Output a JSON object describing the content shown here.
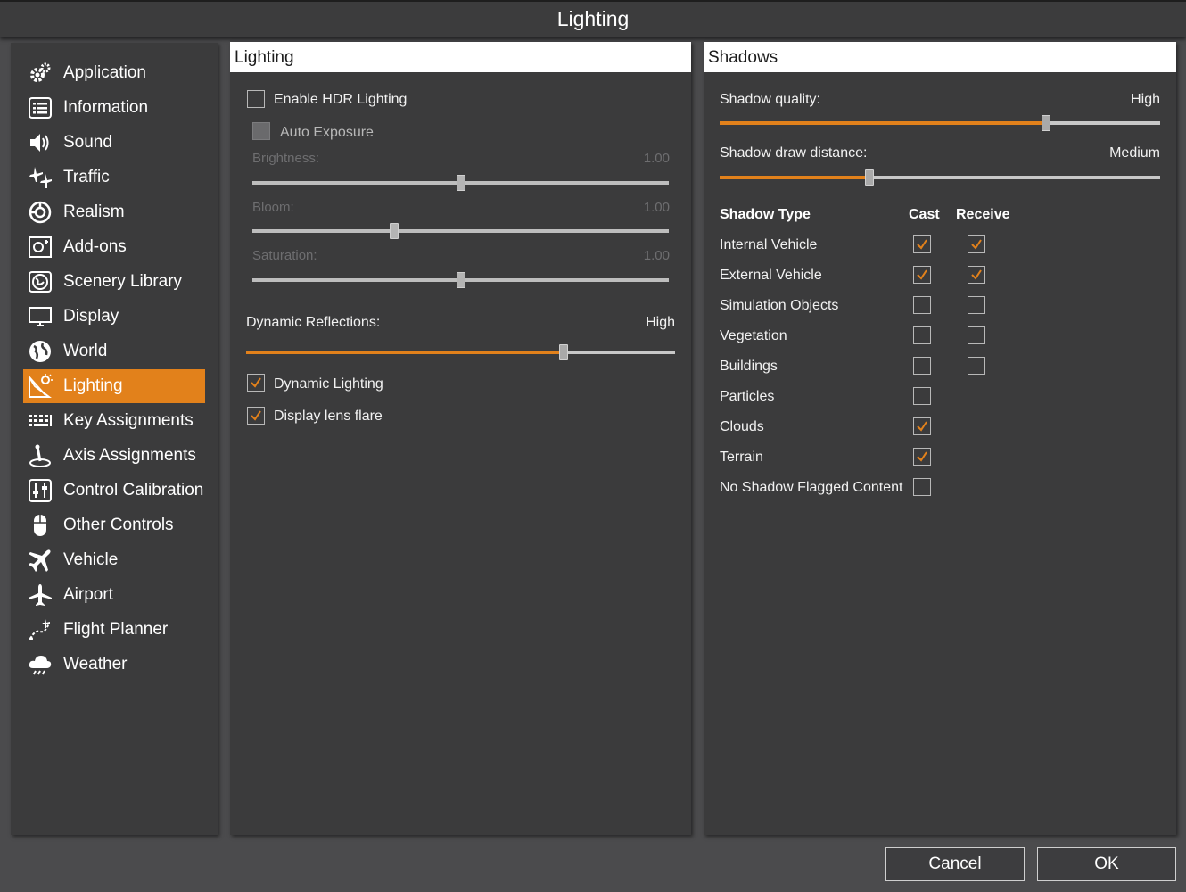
{
  "window": {
    "title": "Lighting"
  },
  "sidebar": {
    "items": [
      {
        "label": "Application",
        "icon": "gears-icon",
        "active": false
      },
      {
        "label": "Information",
        "icon": "list-icon",
        "active": false
      },
      {
        "label": "Sound",
        "icon": "speaker-icon",
        "active": false
      },
      {
        "label": "Traffic",
        "icon": "traffic-planes-icon",
        "active": false
      },
      {
        "label": "Realism",
        "icon": "realism-icon",
        "active": false
      },
      {
        "label": "Add-ons",
        "icon": "addons-icon",
        "active": false
      },
      {
        "label": "Scenery Library",
        "icon": "scenery-icon",
        "active": false
      },
      {
        "label": "Display",
        "icon": "monitor-icon",
        "active": false
      },
      {
        "label": "World",
        "icon": "globe-icon",
        "active": false
      },
      {
        "label": "Lighting",
        "icon": "lighting-icon",
        "active": true
      },
      {
        "label": "Key Assignments",
        "icon": "keyboard-icon",
        "active": false
      },
      {
        "label": "Axis Assignments",
        "icon": "joystick-icon",
        "active": false
      },
      {
        "label": "Control Calibration",
        "icon": "calibration-icon",
        "active": false
      },
      {
        "label": "Other Controls",
        "icon": "mouse-icon",
        "active": false
      },
      {
        "label": "Vehicle",
        "icon": "plane-icon",
        "active": false
      },
      {
        "label": "Airport",
        "icon": "airport-icon",
        "active": false
      },
      {
        "label": "Flight Planner",
        "icon": "flight-planner-icon",
        "active": false
      },
      {
        "label": "Weather",
        "icon": "weather-icon",
        "active": false
      }
    ]
  },
  "lighting": {
    "header": "Lighting",
    "hdr": {
      "label": "Enable HDR Lighting",
      "checked": false
    },
    "auto_exposure": {
      "label": "Auto Exposure",
      "checked": false
    },
    "brightness": {
      "label": "Brightness:",
      "value": "1.00",
      "level": 0.5
    },
    "bloom": {
      "label": "Bloom:",
      "value": "1.00",
      "level": 0.34
    },
    "saturation": {
      "label": "Saturation:",
      "value": "1.00",
      "level": 0.5
    },
    "reflections": {
      "label": "Dynamic Reflections:",
      "value": "High",
      "level": 0.74
    },
    "dynamic_lighting": {
      "label": "Dynamic Lighting",
      "checked": true
    },
    "lens_flare": {
      "label": "Display lens flare",
      "checked": true
    }
  },
  "shadows": {
    "header": "Shadows",
    "quality": {
      "label": "Shadow quality:",
      "value": "High",
      "level": 0.74
    },
    "draw_distance": {
      "label": "Shadow draw distance:",
      "value": "Medium",
      "level": 0.34
    },
    "table": {
      "col_type": "Shadow Type",
      "col_cast": "Cast",
      "col_receive": "Receive",
      "rows": [
        {
          "name": "Internal Vehicle",
          "cast": true,
          "receive": true
        },
        {
          "name": "External Vehicle",
          "cast": true,
          "receive": true
        },
        {
          "name": "Simulation Objects",
          "cast": false,
          "receive": false
        },
        {
          "name": "Vegetation",
          "cast": false,
          "receive": false
        },
        {
          "name": "Buildings",
          "cast": false,
          "receive": false
        },
        {
          "name": "Particles",
          "cast": false,
          "receive": null
        },
        {
          "name": "Clouds",
          "cast": true,
          "receive": null
        },
        {
          "name": "Terrain",
          "cast": true,
          "receive": null
        },
        {
          "name": "No Shadow Flagged Content",
          "cast": false,
          "receive": null
        }
      ]
    }
  },
  "footer": {
    "cancel_label": "Cancel",
    "ok_label": "OK"
  },
  "colors": {
    "accent": "#e2811b",
    "panel": "#3b3b3c",
    "background": "#4b4b4d"
  }
}
